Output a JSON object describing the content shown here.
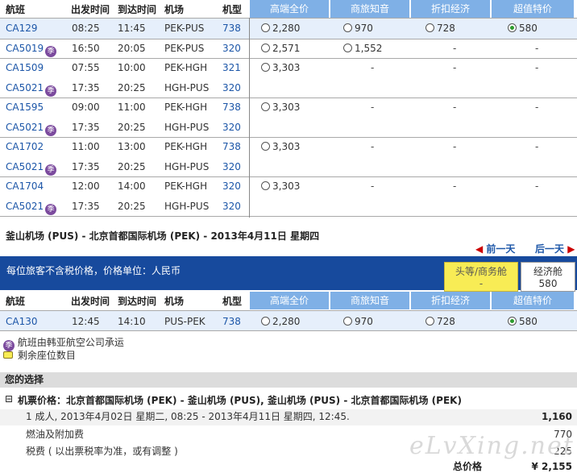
{
  "columns": {
    "flight": "航班",
    "dep": "出发时间",
    "arr": "到达时间",
    "airport": "机场",
    "type": "机型",
    "fares": [
      "高端全价",
      "商旅知音",
      "折扣经济",
      "超值特价"
    ]
  },
  "outbound": [
    {
      "flight": "CA129",
      "badge": false,
      "dep": "08:25",
      "arr": "11:45",
      "route": "PEK-PUS",
      "type": "738",
      "f1": "2,280",
      "f2": "970",
      "f3": "728",
      "f4": "580"
    },
    {
      "flight": "CA5019",
      "badge": true,
      "dep": "16:50",
      "arr": "20:05",
      "route": "PEK-PUS",
      "type": "320",
      "f1": "2,571",
      "f2": "1,552",
      "f3": "-",
      "f4": "-"
    },
    {
      "flight": "CA1509",
      "badge": false,
      "dep": "07:55",
      "arr": "10:00",
      "route": "PEK-HGH",
      "type": "321",
      "f1": "3,303",
      "f2": "-",
      "f3": "-",
      "f4": "-"
    },
    {
      "flight": "CA5021",
      "badge": true,
      "dep": "17:35",
      "arr": "20:25",
      "route": "HGH-PUS",
      "type": "320"
    },
    {
      "flight": "CA1595",
      "badge": false,
      "dep": "09:00",
      "arr": "11:00",
      "route": "PEK-HGH",
      "type": "738",
      "f1": "3,303",
      "f2": "-",
      "f3": "-",
      "f4": "-"
    },
    {
      "flight": "CA5021",
      "badge": true,
      "dep": "17:35",
      "arr": "20:25",
      "route": "HGH-PUS",
      "type": "320"
    },
    {
      "flight": "CA1702",
      "badge": false,
      "dep": "11:00",
      "arr": "13:00",
      "route": "PEK-HGH",
      "type": "738",
      "f1": "3,303",
      "f2": "-",
      "f3": "-",
      "f4": "-"
    },
    {
      "flight": "CA5021",
      "badge": true,
      "dep": "17:35",
      "arr": "20:25",
      "route": "HGH-PUS",
      "type": "320"
    },
    {
      "flight": "CA1704",
      "badge": false,
      "dep": "12:00",
      "arr": "14:00",
      "route": "PEK-HGH",
      "type": "320",
      "f1": "3,303",
      "f2": "-",
      "f3": "-",
      "f4": "-"
    },
    {
      "flight": "CA5021",
      "badge": true,
      "dep": "17:35",
      "arr": "20:25",
      "route": "HGH-PUS",
      "type": "320"
    }
  ],
  "badge_glyph": "季",
  "return_title": "釜山机场 (PUS) - 北京首都国际机场 (PEK) - 2013年4月11日 星期四",
  "nav": {
    "prev": "前一天",
    "next": "后一天",
    "prev_arrow": "◀",
    "next_arrow": "▶"
  },
  "ribbon_text": "每位旅客不含税价格，价格单位：人民币",
  "tabs": {
    "first_label": "头等/商务舱",
    "first_price": "-",
    "eco_label": "经济舱",
    "eco_price": "580"
  },
  "return_row": {
    "flight": "CA130",
    "dep": "12:45",
    "arr": "14:10",
    "route": "PUS-PEK",
    "type": "738",
    "f1": "2,280",
    "f2": "970",
    "f3": "728",
    "f4": "580"
  },
  "legend": {
    "codeshare": "航班由韩亚航空公司承运",
    "seats": "剩余座位数目"
  },
  "summary": {
    "title": "您的选择",
    "fare_line": "机票价格：北京首都国际机场 (PEK) - 釜山机场 (PUS), 釜山机场 (PUS) - 北京首都国际机场 (PEK)",
    "collapse": "⊟",
    "detail": "1 成人, 2013年4月02日 星期二, 08:25 - 2013年4月11日 星期四, 12:45.",
    "detail_amt": "1,160",
    "fuel": "燃油及附加费",
    "fuel_amt": "770",
    "tax": "税费 ( 以出票税率为准，或有调整 )",
    "tax_amt": "225",
    "total_label": "总价格",
    "total_amt": "¥ 2,155"
  },
  "watermark": "eLvXing.net"
}
